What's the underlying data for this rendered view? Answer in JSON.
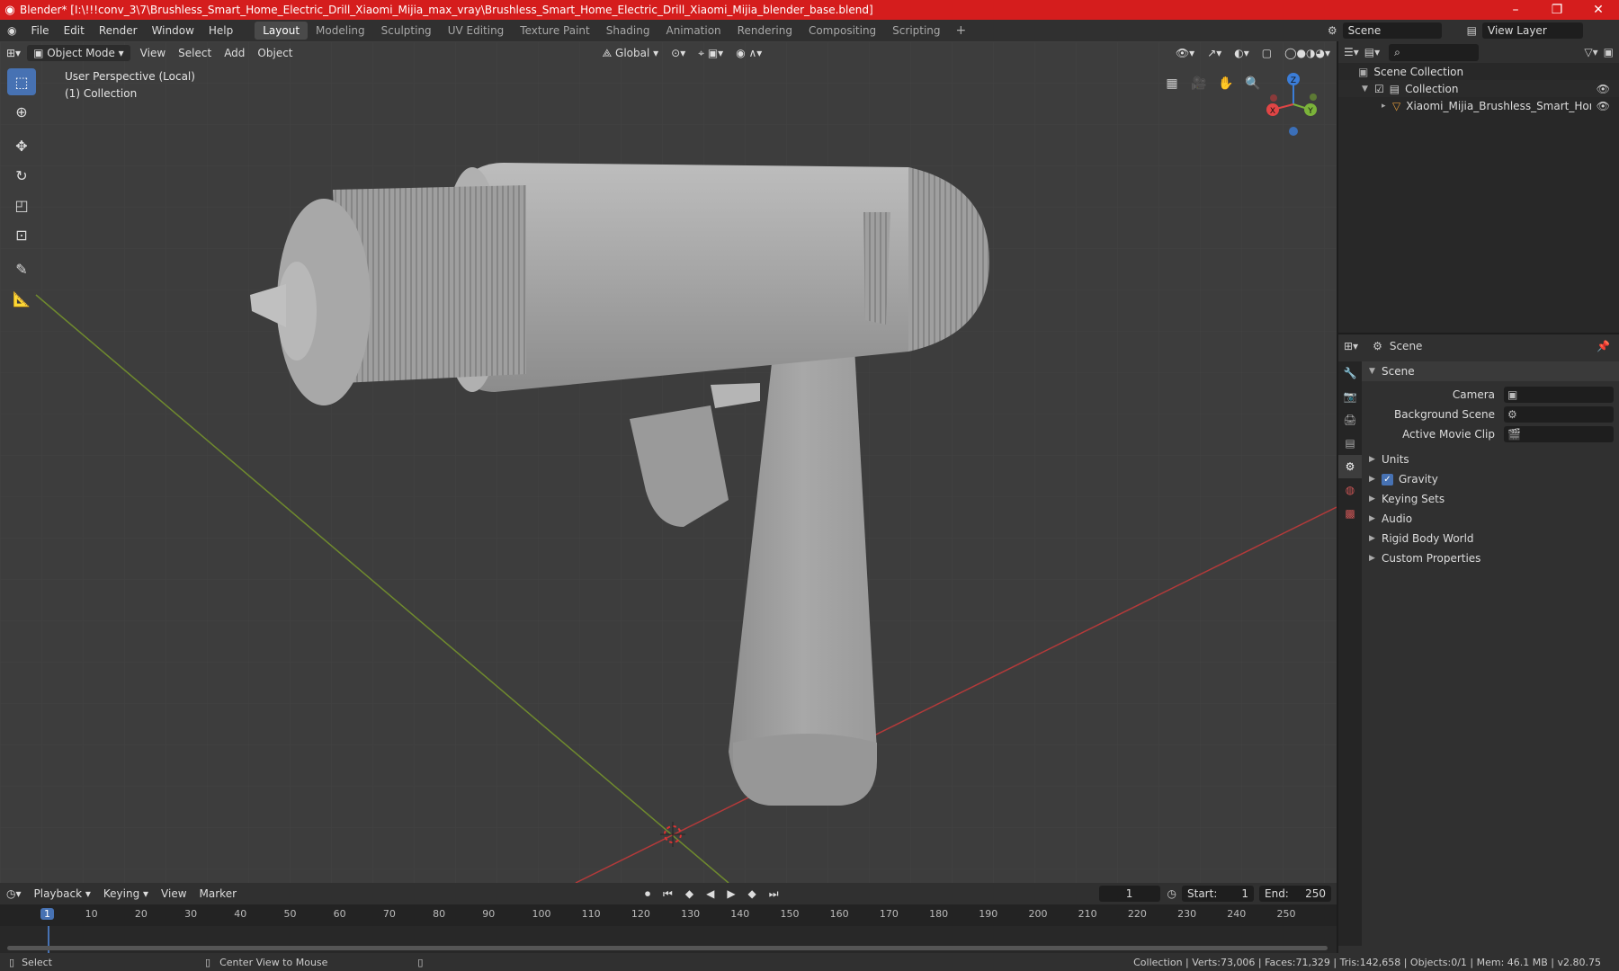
{
  "window": {
    "title": "Blender* [I:\\!!!conv_3\\7\\Brushless_Smart_Home_Electric_Drill_Xiaomi_Mijia_max_vray\\Brushless_Smart_Home_Electric_Drill_Xiaomi_Mijia_blender_base.blend]",
    "minimize": "–",
    "maximize": "❐",
    "close": "✕"
  },
  "menu": [
    "File",
    "Edit",
    "Render",
    "Window",
    "Help"
  ],
  "workspaces": [
    "Layout",
    "Modeling",
    "Sculpting",
    "UV Editing",
    "Texture Paint",
    "Shading",
    "Animation",
    "Rendering",
    "Compositing",
    "Scripting"
  ],
  "active_workspace": "Layout",
  "topright": {
    "scene": "Scene",
    "view_layer": "View Layer"
  },
  "viewport_header": {
    "mode": "Object Mode",
    "menus": [
      "View",
      "Select",
      "Add",
      "Object"
    ],
    "orientation": "Global"
  },
  "viewport_info": {
    "line1": "User Perspective (Local)",
    "line2": "(1) Collection"
  },
  "gizmo": {
    "x": "X",
    "y": "Y",
    "z": "Z"
  },
  "outliner": {
    "search_placeholder": "",
    "rows": [
      {
        "label": "Scene Collection"
      },
      {
        "label": "Collection"
      },
      {
        "label": "Xiaomi_Mijia_Brushless_Smart_Home_Electr"
      }
    ]
  },
  "properties": {
    "header": "Scene",
    "section": "Scene",
    "fields": [
      {
        "label": "Camera"
      },
      {
        "label": "Background Scene"
      },
      {
        "label": "Active Movie Clip"
      }
    ],
    "panels": [
      "Units",
      "Gravity",
      "Keying Sets",
      "Audio",
      "Rigid Body World",
      "Custom Properties"
    ]
  },
  "timeline": {
    "menus": [
      "Playback",
      "Keying",
      "View",
      "Marker"
    ],
    "current_frame": "1",
    "start_label": "Start:",
    "start": "1",
    "end_label": "End:",
    "end": "250",
    "ticks": [
      "1",
      "10",
      "20",
      "30",
      "40",
      "50",
      "60",
      "70",
      "80",
      "90",
      "100",
      "110",
      "120",
      "130",
      "140",
      "150",
      "160",
      "170",
      "180",
      "190",
      "200",
      "210",
      "220",
      "230",
      "240",
      "250"
    ]
  },
  "status": {
    "select": "Select",
    "center": "Center View to Mouse",
    "stats": "Collection | Verts:73,006 | Faces:71,329 | Tris:142,658 | Objects:0/1 | Mem: 46.1 MB | v2.80.75"
  },
  "colors": {
    "accent": "#4772b3",
    "title_bar": "#d51d1d",
    "x_axis": "#b33a3a",
    "y_axis": "#6f8a2e"
  }
}
